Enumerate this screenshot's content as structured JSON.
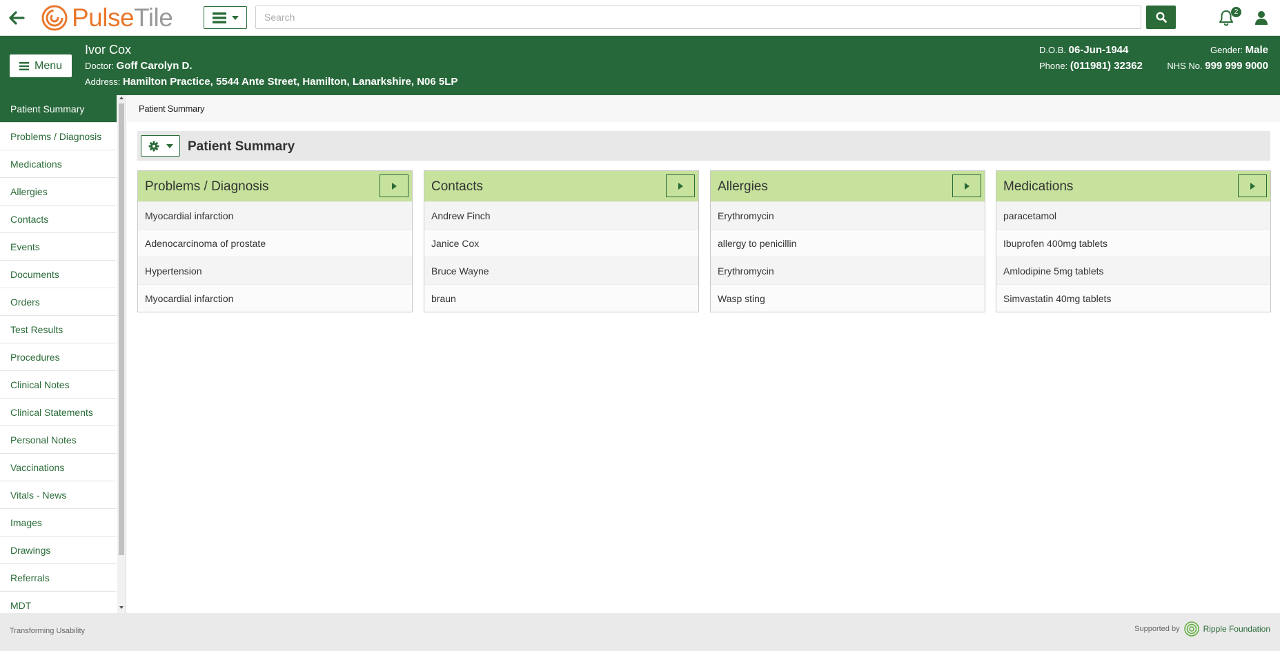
{
  "app": {
    "logo_part1": "Pulse",
    "logo_part2": "Tile"
  },
  "topbar": {
    "search_placeholder": "Search",
    "notification_count": "2"
  },
  "patient": {
    "name": "Ivor Cox",
    "doctor_label": "Doctor:",
    "doctor": "Goff Carolyn D.",
    "address_label": "Address:",
    "address": "Hamilton Practice, 5544 Ante Street, Hamilton, Lanarkshire, N06 5LP",
    "dob_label": "D.O.B.",
    "dob": "06-Jun-1944",
    "phone_label": "Phone:",
    "phone": "(011981) 32362",
    "gender_label": "Gender:",
    "gender": "Male",
    "nhs_label": "NHS No.",
    "nhs": "999 999 9000"
  },
  "menu_button": "Menu",
  "sidebar": {
    "items": [
      {
        "label": "Patient Summary",
        "active": true
      },
      {
        "label": "Problems / Diagnosis"
      },
      {
        "label": "Medications"
      },
      {
        "label": "Allergies"
      },
      {
        "label": "Contacts"
      },
      {
        "label": "Events"
      },
      {
        "label": "Documents"
      },
      {
        "label": "Orders"
      },
      {
        "label": "Test Results"
      },
      {
        "label": "Procedures"
      },
      {
        "label": "Clinical Notes"
      },
      {
        "label": "Clinical Statements"
      },
      {
        "label": "Personal Notes"
      },
      {
        "label": "Vaccinations"
      },
      {
        "label": "Vitals - News"
      },
      {
        "label": "Images"
      },
      {
        "label": "Drawings"
      },
      {
        "label": "Referrals"
      },
      {
        "label": "MDT"
      }
    ]
  },
  "main": {
    "breadcrumb": "Patient Summary",
    "panel_title": "Patient Summary",
    "cards": [
      {
        "title": "Problems / Diagnosis",
        "rows": [
          "Myocardial infarction",
          "Adenocarcinoma of prostate",
          "Hypertension",
          "Myocardial infarction"
        ]
      },
      {
        "title": "Contacts",
        "rows": [
          "Andrew Finch",
          "Janice Cox",
          "Bruce Wayne",
          "braun"
        ]
      },
      {
        "title": "Allergies",
        "rows": [
          "Erythromycin",
          "allergy to penicillin",
          "Erythromycin",
          "Wasp sting"
        ]
      },
      {
        "title": "Medications",
        "rows": [
          "paracetamol",
          "Ibuprofen 400mg tablets",
          "Amlodipine 5mg tablets",
          "Simvastatin 40mg tablets"
        ]
      }
    ]
  },
  "footer": {
    "left": "Transforming Usability",
    "supported_by": "Supported by",
    "foundation": "Ripple Foundation"
  },
  "colors": {
    "primary_green": "#27683a",
    "card_header_green": "#c6e29c",
    "logo_orange": "#e9772c"
  }
}
